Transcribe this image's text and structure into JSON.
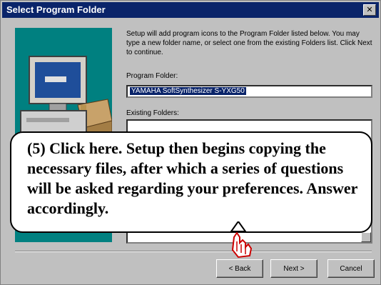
{
  "window": {
    "title": "Select Program Folder",
    "close_glyph": "✕"
  },
  "description": "Setup will add program icons to the Program Folder listed below. You may type a new folder name, or select one from the existing Folders list. Click Next to continue.",
  "program_folder": {
    "label": "Program Folder:",
    "value": "YAMAHA SoftSynthesizer S-YXG50"
  },
  "existing_folders": {
    "label": "Existing Folders:"
  },
  "buttons": {
    "back": "< Back",
    "next": "Next >",
    "cancel": "Cancel"
  },
  "callout": {
    "text": "(5) Click here.  Setup then begins copying the necessary files, after which a series of questions will be asked regarding your preferences. Answer accordingly."
  },
  "icons": {
    "pointer": "hand-pointer-icon",
    "computer": "computer-icon"
  },
  "colors": {
    "title_bar": "#0a246a",
    "dialog": "#c0c0c0",
    "graphic": "#008080"
  }
}
